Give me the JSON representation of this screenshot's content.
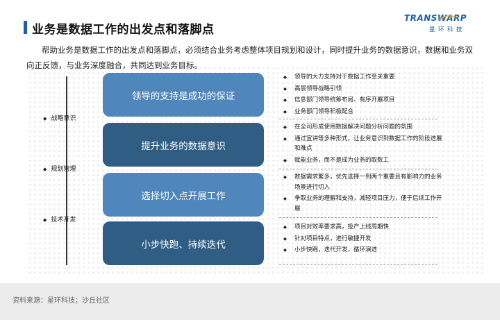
{
  "title": "业务是数据工作的出发点和落脚点",
  "logo": {
    "brand": "TRANSWARP",
    "subtitle": "星环科技"
  },
  "intro": "帮助业务是数据工作的出发点和落脚点，必须结合业务考虑整体项目规划和设计，同时提升业务的数据意识，数据和业务双向正反馈，与业务深度融合，共同达到业务目标。",
  "side_labels": [
    "战略意识",
    "规划管理",
    "技术开发"
  ],
  "diamond": "◆",
  "sections": [
    {
      "label": "领导的支持是成功的保证",
      "bullets": [
        "领导的大力支持对于数据工作至关重要",
        "高层领导战略引领",
        "信息部门领导统筹布局、有序开展项目",
        "业务部门领导积极配合"
      ]
    },
    {
      "label": "提升业务的数据意识",
      "bullets": [
        "在全司形成使用数据解决问题分析问题的氛围",
        "通过宣讲等多种形式，让业务意识到数据工作的阶段进展和难点",
        "赋能业务，而不是成为业务的取数工"
      ]
    },
    {
      "label": "选择切入点开展工作",
      "bullets": [
        "数据需求繁多，优先选择一到两个重要且有影响力的业务场景进行切入",
        "争取业务的理解和支持，减轻项目压力，便于后续工作开展"
      ]
    },
    {
      "label": "小步快跑、持续迭代",
      "bullets": [
        "项目对效率要求高，投产上线周期快",
        "针对项目特点，进行敏捷开发",
        "小步快跑，迭代开发，循环演进"
      ]
    }
  ],
  "source": "资料来源：星环科技；沙丘社区",
  "colors": {
    "accent": "#1f5fa8",
    "box_light": "#4f86bb",
    "box_dark": "#2f5d84"
  }
}
